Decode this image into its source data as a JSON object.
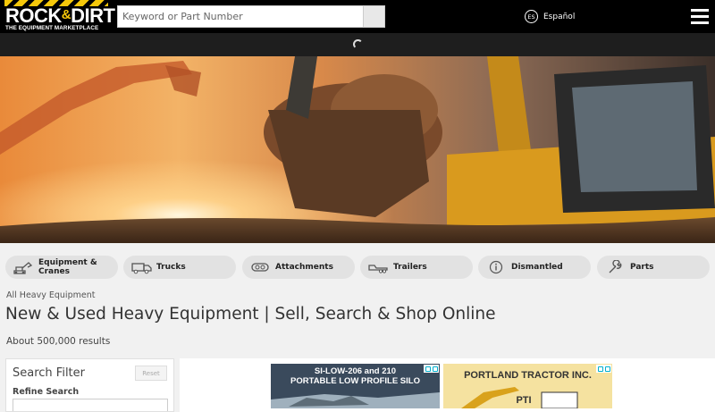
{
  "header": {
    "logo_main": "ROCK",
    "logo_amp": "&",
    "logo_main2": "DIRT",
    "logo_tagline": "THE EQUIPMENT MARKETPLACE",
    "search_placeholder": "Keyword or Part Number",
    "lang_code": "ES",
    "lang_label": "Español"
  },
  "categories": [
    {
      "label": "Equipment &\nCranes",
      "icon": "excavator-icon"
    },
    {
      "label": "Trucks",
      "icon": "truck-icon"
    },
    {
      "label": "Attachments",
      "icon": "attachment-icon"
    },
    {
      "label": "Trailers",
      "icon": "trailer-icon"
    },
    {
      "label": "Dismantled",
      "icon": "info-circle-icon"
    },
    {
      "label": "Parts",
      "icon": "wrench-icon"
    }
  ],
  "breadcrumb": "All Heavy Equipment",
  "page_title": "New & Used Heavy Equipment | Sell, Search & Shop Online",
  "results_text": "About 500,000 results",
  "filter": {
    "title": "Search Filter",
    "reset_label": "Reset",
    "refine_label": "Refine Search"
  },
  "ads": [
    {
      "line1": "SI-LOW-206 and 210",
      "line2": "PORTABLE LOW PROFILE SILO"
    },
    {
      "line1": "PORTLAND TRACTOR INC.",
      "line2": "PTI"
    }
  ],
  "colors": {
    "brand_yellow": "#f6c80a",
    "header_bg": "#000000",
    "pill_bg": "#e2e2e2"
  }
}
